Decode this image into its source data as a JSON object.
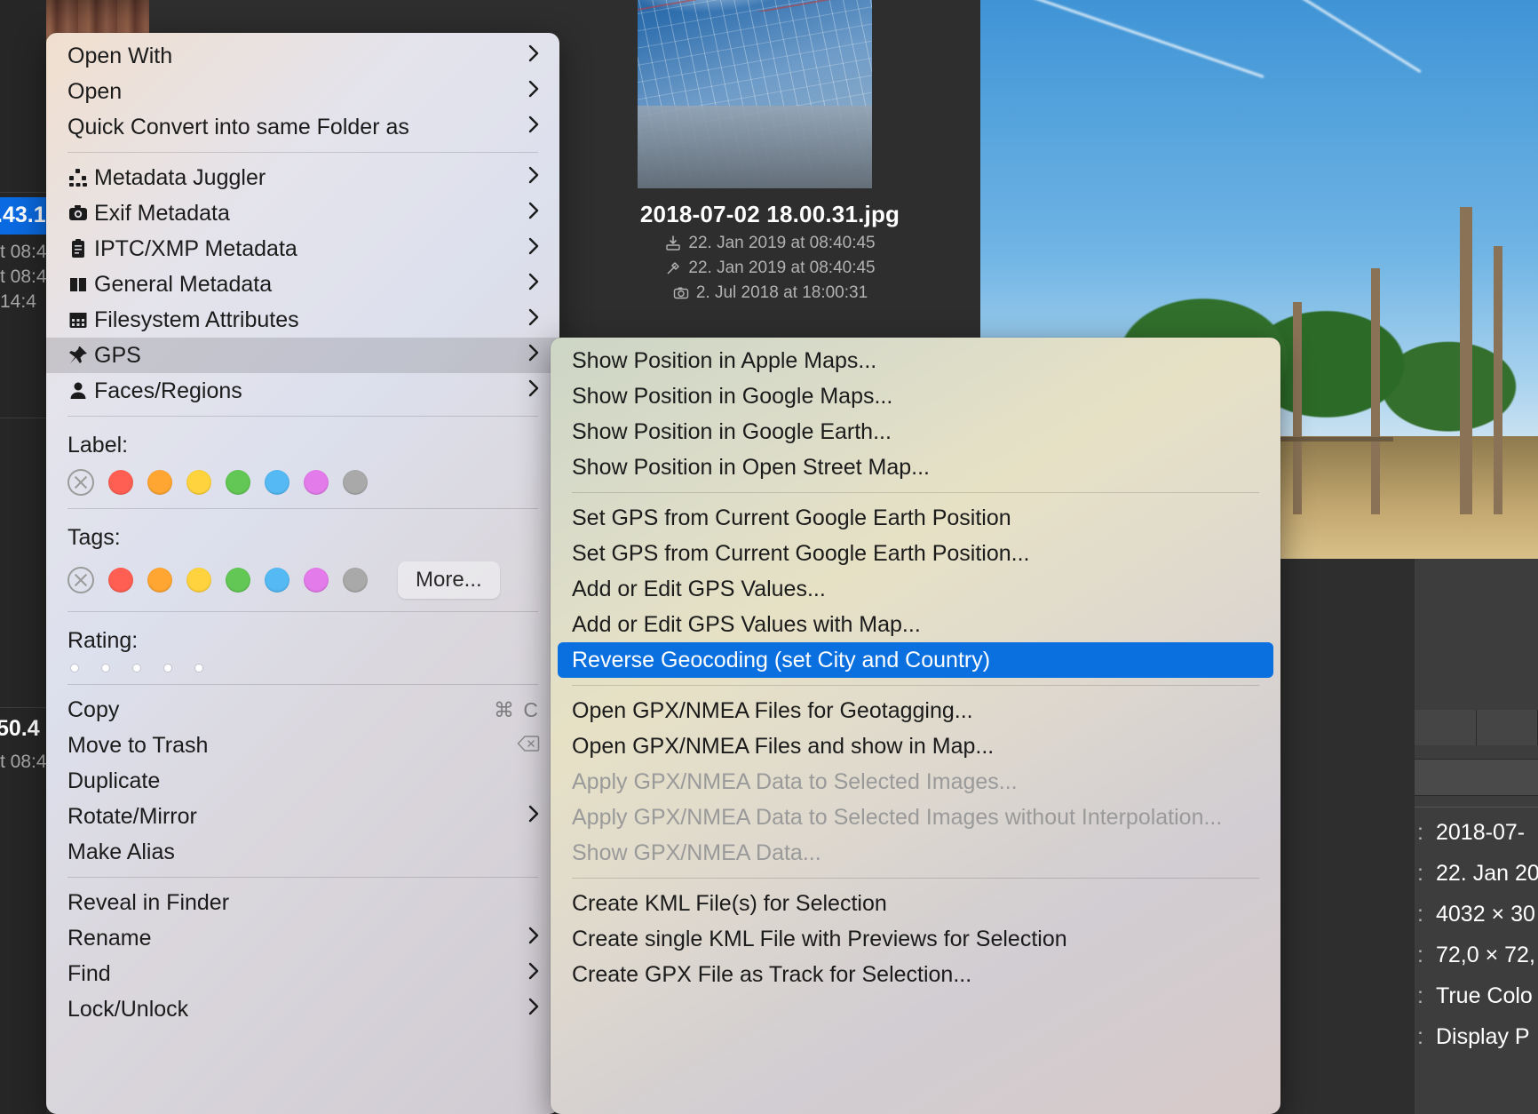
{
  "app": {
    "selected_file": {
      "name": "2018-07-02 18.00.31.jpg",
      "added": "22. Jan 2019 at 08:40:45",
      "modified": "22. Jan 2019 at 08:40:45",
      "captured": "2. Jul 2018 at 18:00:31"
    },
    "left_strip": {
      "selected_row_text": ".43.1",
      "rows": [
        "t 08:4",
        "t 08:4",
        "14:4"
      ],
      "second_selected_text": "50.4",
      "second_rows": [
        "t 08:4"
      ]
    },
    "inspector": {
      "rows": [
        {
          "sep": ":",
          "value": "2018-07-"
        },
        {
          "sep": ":",
          "value": "22. Jan 20"
        },
        {
          "sep": ":",
          "value": "4032 × 30"
        },
        {
          "sep": ":",
          "value": "72,0 × 72,"
        },
        {
          "sep": ":",
          "value": "True Colo"
        },
        {
          "sep": ":",
          "value": "Display P"
        }
      ]
    }
  },
  "context_menu": {
    "groups": [
      {
        "items": [
          {
            "label": "Open With",
            "icon": null,
            "submenu": true
          },
          {
            "label": "Open",
            "icon": null,
            "submenu": true
          },
          {
            "label": "Quick Convert into same Folder as",
            "icon": null,
            "submenu": true
          }
        ]
      },
      {
        "items": [
          {
            "label": "Metadata Juggler",
            "icon": "metadata-juggler-icon",
            "submenu": true
          },
          {
            "label": "Exif Metadata",
            "icon": "camera-icon",
            "submenu": true
          },
          {
            "label": "IPTC/XMP Metadata",
            "icon": "clipboard-icon",
            "submenu": true
          },
          {
            "label": "General Metadata",
            "icon": "book-icon",
            "submenu": true
          },
          {
            "label": "Filesystem Attributes",
            "icon": "calendar-icon",
            "submenu": true
          },
          {
            "label": "GPS",
            "icon": "pin-icon",
            "submenu": true,
            "highlighted": true
          },
          {
            "label": "Faces/Regions",
            "icon": "person-icon",
            "submenu": true
          }
        ]
      }
    ],
    "label_section": {
      "title": "Label:",
      "colors": [
        "#ff5f52",
        "#ffa531",
        "#ffd33d",
        "#62c754",
        "#55b9f3",
        "#e47bea",
        "#a9a9a9"
      ]
    },
    "tags_section": {
      "title": "Tags:",
      "colors": [
        "#ff5f52",
        "#ffa531",
        "#ffd33d",
        "#62c754",
        "#55b9f3",
        "#e47bea",
        "#a9a9a9"
      ],
      "more_label": "More..."
    },
    "rating_section": {
      "title": "Rating:",
      "stars": 5
    },
    "bottom_groups": [
      {
        "items": [
          {
            "label": "Copy",
            "shortcut": "⌘ C"
          },
          {
            "label": "Move to Trash",
            "shortcut_icon": "delete-key-icon"
          },
          {
            "label": "Duplicate"
          },
          {
            "label": "Rotate/Mirror",
            "submenu": true
          },
          {
            "label": "Make Alias"
          }
        ]
      },
      {
        "items": [
          {
            "label": "Reveal in Finder"
          },
          {
            "label": "Rename",
            "submenu": true
          },
          {
            "label": "Find",
            "submenu": true
          },
          {
            "label": "Lock/Unlock",
            "submenu": true
          }
        ]
      }
    ]
  },
  "gps_submenu": {
    "groups": [
      {
        "items": [
          {
            "label": "Show Position in Apple Maps..."
          },
          {
            "label": "Show Position in Google Maps..."
          },
          {
            "label": "Show Position in Google Earth..."
          },
          {
            "label": "Show Position in Open Street Map..."
          }
        ]
      },
      {
        "items": [
          {
            "label": "Set GPS from Current Google Earth Position"
          },
          {
            "label": "Set GPS from Current Google Earth Position..."
          },
          {
            "label": "Add or Edit GPS Values..."
          },
          {
            "label": "Add or Edit GPS Values with Map..."
          },
          {
            "label": "Reverse Geocoding (set City and Country)",
            "selected": true
          }
        ]
      },
      {
        "items": [
          {
            "label": "Open GPX/NMEA Files for Geotagging..."
          },
          {
            "label": "Open GPX/NMEA Files and show in Map..."
          },
          {
            "label": "Apply GPX/NMEA Data to Selected Images...",
            "disabled": true
          },
          {
            "label": "Apply GPX/NMEA Data to Selected Images without Interpolation...",
            "disabled": true
          },
          {
            "label": "Show GPX/NMEA Data...",
            "disabled": true
          }
        ]
      },
      {
        "items": [
          {
            "label": "Create KML File(s) for Selection"
          },
          {
            "label": "Create single KML File with Previews for Selection"
          },
          {
            "label": "Create GPX File as Track for Selection..."
          }
        ]
      }
    ]
  },
  "colors": {
    "accent": "#0a70e0",
    "menu_bg": "#d3cfd6",
    "app_bg": "#2e2e2e"
  }
}
